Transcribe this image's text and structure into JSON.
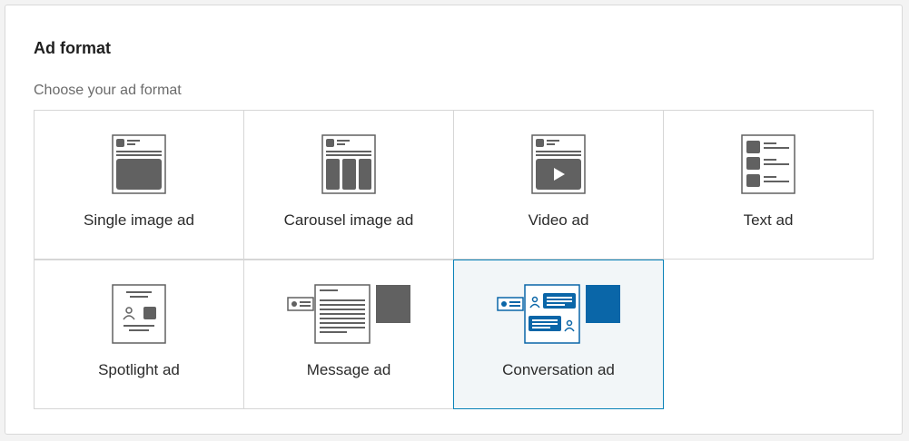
{
  "panel": {
    "title": "Ad format",
    "subtitle": "Choose your ad format"
  },
  "formats": [
    {
      "label": "Single image ad",
      "icon": "single-image-icon",
      "selected": false
    },
    {
      "label": "Carousel image ad",
      "icon": "carousel-image-icon",
      "selected": false
    },
    {
      "label": "Video ad",
      "icon": "video-icon",
      "selected": false
    },
    {
      "label": "Text ad",
      "icon": "text-ad-icon",
      "selected": false
    },
    {
      "label": "Spotlight ad",
      "icon": "spotlight-icon",
      "selected": false
    },
    {
      "label": "Message ad",
      "icon": "message-icon",
      "selected": false
    },
    {
      "label": "Conversation ad",
      "icon": "conversation-icon",
      "selected": true
    }
  ],
  "colors": {
    "icon_gray": "#616161",
    "accent_blue": "#0a66a8",
    "selected_border": "#0a82b8",
    "selected_bg": "#f2f6f8"
  }
}
